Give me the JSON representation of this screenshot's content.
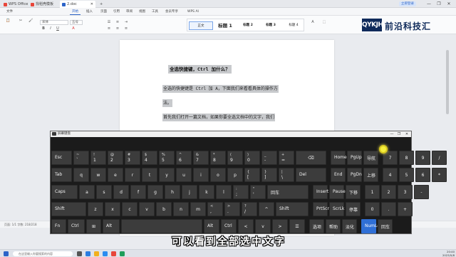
{
  "titlebar": {
    "tabs": [
      {
        "label": "WPS Office",
        "color": "#e8463a"
      },
      {
        "label": "找稻壳模板",
        "color": "#e8463a"
      },
      {
        "label": "2.doc",
        "color": "#2d64c8"
      }
    ],
    "new_tab": "+",
    "login_label": "立即登录",
    "win_controls": [
      "—",
      "❐",
      "✕"
    ]
  },
  "menubar": {
    "items": [
      "文件",
      "开始",
      "插入",
      "页面",
      "引用",
      "审阅",
      "视图",
      "工具",
      "会员专享",
      "WPS AI"
    ],
    "active": "开始"
  },
  "ribbon": {
    "font_name": "宋体",
    "font_size": "五号",
    "styles": [
      "正文",
      "标题 1",
      "标题 2",
      "标题 3",
      "标题 4"
    ],
    "selected_style": "正文"
  },
  "logo": {
    "mark": "QYKJH",
    "name": "前沿科技汇"
  },
  "document": {
    "title": "全选快捷键，Ctrl 加什么？",
    "lines": [
      "全选的快捷键是 Ctrl 加 A，下面我们来看看具体的操作方",
      "法。",
      "首先我们打开一篇文档，如果你要全选文档中的文字，我们"
    ]
  },
  "statusbar": {
    "left": "页面: 1/1   字数: 218/218"
  },
  "osk": {
    "title": "屏幕键盘",
    "controls": [
      "—",
      "❐",
      "✕"
    ],
    "row1": [
      {
        "t": "Esc"
      },
      {
        "t": "~",
        "b": "`"
      },
      {
        "t": "!",
        "b": "1"
      },
      {
        "t": "@",
        "b": "2"
      },
      {
        "t": "#",
        "b": "3"
      },
      {
        "t": "$",
        "b": "4"
      },
      {
        "t": "%",
        "b": "5"
      },
      {
        "t": "^",
        "b": "6"
      },
      {
        "t": "&",
        "b": "7"
      },
      {
        "t": "*",
        "b": "8"
      },
      {
        "t": "(",
        "b": "9"
      },
      {
        "t": ")",
        "b": "0"
      },
      {
        "t": "_",
        "b": "-"
      },
      {
        "t": "+",
        "b": "="
      },
      {
        "t": "⌫"
      },
      {
        "t": "Home"
      },
      {
        "t": "PgUp"
      },
      {
        "t": "导航"
      },
      {
        "t": "7"
      },
      {
        "t": "8"
      },
      {
        "t": "9"
      },
      {
        "t": "/"
      }
    ],
    "row2": [
      {
        "t": "Tab"
      },
      {
        "t": "q"
      },
      {
        "t": "w"
      },
      {
        "t": "e"
      },
      {
        "t": "r"
      },
      {
        "t": "t"
      },
      {
        "t": "y"
      },
      {
        "t": "u"
      },
      {
        "t": "i"
      },
      {
        "t": "o"
      },
      {
        "t": "p"
      },
      {
        "t": "{",
        "b": "["
      },
      {
        "t": "}",
        "b": "]"
      },
      {
        "t": "|",
        "b": "\\"
      },
      {
        "t": "Del"
      },
      {
        "t": "End"
      },
      {
        "t": "PgDn"
      },
      {
        "t": "上移"
      },
      {
        "t": "4"
      },
      {
        "t": "5"
      },
      {
        "t": "6"
      },
      {
        "t": "*"
      }
    ],
    "row3": [
      {
        "t": "Caps"
      },
      {
        "t": "a"
      },
      {
        "t": "s"
      },
      {
        "t": "d"
      },
      {
        "t": "f"
      },
      {
        "t": "g"
      },
      {
        "t": "h"
      },
      {
        "t": "j"
      },
      {
        "t": "k"
      },
      {
        "t": "l"
      },
      {
        "t": ":",
        "b": ";"
      },
      {
        "t": "\"",
        "b": "'"
      },
      {
        "t": "回车"
      },
      {
        "t": "Insert"
      },
      {
        "t": "Pause"
      },
      {
        "t": "下移"
      },
      {
        "t": "1"
      },
      {
        "t": "2"
      },
      {
        "t": "3"
      },
      {
        "t": "-"
      }
    ],
    "row4": [
      {
        "t": "Shift"
      },
      {
        "t": "z"
      },
      {
        "t": "x"
      },
      {
        "t": "c"
      },
      {
        "t": "v"
      },
      {
        "t": "b"
      },
      {
        "t": "n"
      },
      {
        "t": "m"
      },
      {
        "t": "<",
        "b": ","
      },
      {
        "t": ">",
        "b": "."
      },
      {
        "t": "?",
        "b": "/"
      },
      {
        "t": "^"
      },
      {
        "t": "Shift"
      },
      {
        "t": "PrtScn"
      },
      {
        "t": "ScrLk"
      },
      {
        "t": "停靠"
      },
      {
        "t": "0"
      },
      {
        "t": "."
      },
      {
        "t": "+"
      }
    ],
    "row5": [
      {
        "t": "Fn"
      },
      {
        "t": "Ctrl"
      },
      {
        "t": "⊞"
      },
      {
        "t": "Alt"
      },
      {
        "t": ""
      },
      {
        "t": "Alt"
      },
      {
        "t": "Ctrl"
      },
      {
        "t": "<"
      },
      {
        "t": "v"
      },
      {
        "t": ">"
      },
      {
        "t": "☰"
      },
      {
        "t": "选项"
      },
      {
        "t": "帮助"
      },
      {
        "t": "淡化"
      },
      {
        "t": "NumLock"
      },
      {
        "t": "回车"
      }
    ]
  },
  "subtitle": "可以看到全部选中文字",
  "taskbar": {
    "search_placeholder": "在这里输入你要搜索的内容",
    "clock_time": "20:40",
    "clock_date": "2023/5/8"
  }
}
